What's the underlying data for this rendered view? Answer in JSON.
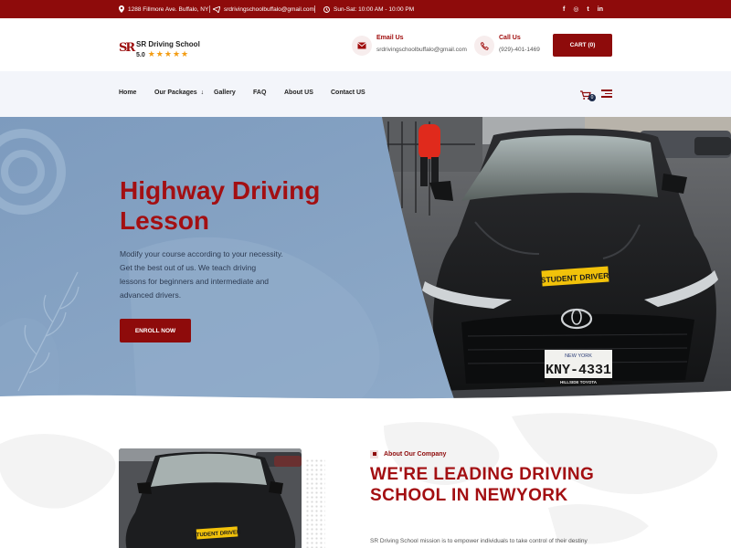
{
  "topbar": {
    "address": "1288 Fillmore Ave. Buffalo, NY",
    "email": "srdrivingschoolbuffalo@gmail.com",
    "hours": "Sun-Sat: 10:00 AM - 10:00 PM",
    "social": [
      "f",
      "◎",
      "t",
      "in"
    ]
  },
  "header": {
    "logo_name": "SR Driving School",
    "logo_mark": "SR",
    "rating": "5.0",
    "stars": "★★★★★",
    "email_title": "Email Us",
    "email_value": "srdrivingschoolbuffalo@gmail.com",
    "call_title": "Call Us",
    "call_value": "(929)-401-1469",
    "cart_label": "CART (0)"
  },
  "nav": {
    "items": [
      "Home",
      "Our Packages",
      "Gallery",
      "FAQ",
      "About US",
      "Contact US"
    ],
    "dropdown_arrow": "↓",
    "cart_count": "0"
  },
  "hero": {
    "title": "Highway Driving Lesson",
    "text": "Modify your course according to your necessity. Get the best out of us. We teach driving lessons for beginners and intermediate and advanced drivers.",
    "button": "ENROLL NOW",
    "sticker": "STUDENT DRIVER",
    "plate": "KNY-4331",
    "plate_top": "NEW YORK",
    "plate_bottom": "HILLSIDE TOYOTA"
  },
  "about": {
    "kicker": "About Our Company",
    "title": "WE'RE LEADING DRIVING SCHOOL IN NEWYORK",
    "text": "SR Driving School mission is to empower individuals to take control of their destiny",
    "sticker": "STUDENT DRIVER"
  },
  "colors": {
    "brand": "#8e0b0b",
    "heading": "#a30f12",
    "hero_bg": "#87a4c5",
    "nav_bg": "#f3f5fa",
    "star": "#f39c12"
  }
}
